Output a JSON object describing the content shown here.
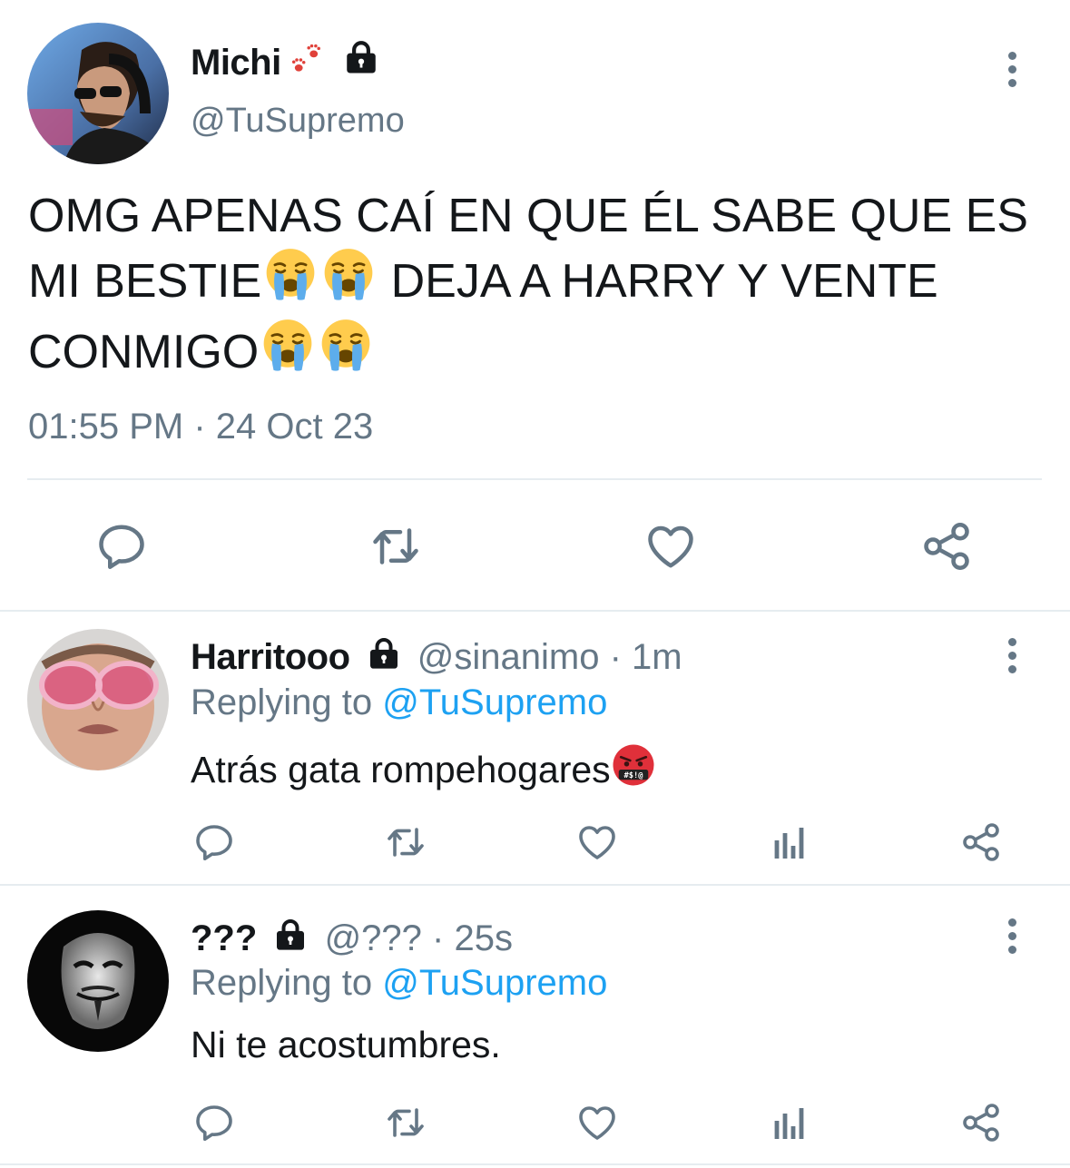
{
  "main_tweet": {
    "display_name": "Michi",
    "name_emoji": "paw-prints-emoji",
    "protected": "lock-icon",
    "handle": "@TuSupremo",
    "text_line1": "OMG APENAS CAÍ EN QUE ÉL SABE QUE ES",
    "text_line2a": "MI BESTIE",
    "text_line2b": " DEJA A HARRY Y VENTE",
    "text_line3": "CONMIGO",
    "text_emoji": "loudly-crying-face",
    "time": "01:55 PM",
    "separator": "·",
    "date": "24 Oct 23"
  },
  "replies": [
    {
      "display_name": "Harritooo",
      "handle": "@sinanimo",
      "separator": "·",
      "age": "1m",
      "replying_prefix": "Replying to",
      "replying_to": "@TuSupremo",
      "text": "Atrás gata rompehogares",
      "text_emoji": "face-with-symbols-on-mouth"
    },
    {
      "display_name": "???",
      "handle": "@???",
      "separator": "·",
      "age": "25s",
      "replying_prefix": "Replying to",
      "replying_to": "@TuSupremo",
      "text": "Ni te acostumbres."
    }
  ],
  "icons": {
    "reply": "reply-icon",
    "retweet": "retweet-icon",
    "like": "like-icon",
    "share": "share-icon",
    "analytics": "analytics-icon",
    "more": "more-vertical-icon"
  },
  "colors": {
    "text": "#14171a",
    "secondary": "#657786",
    "link": "#1da1f2",
    "divider": "#e6ecf0",
    "emoji_face": "#ffcc4d",
    "angry_face": "#e0303a"
  }
}
